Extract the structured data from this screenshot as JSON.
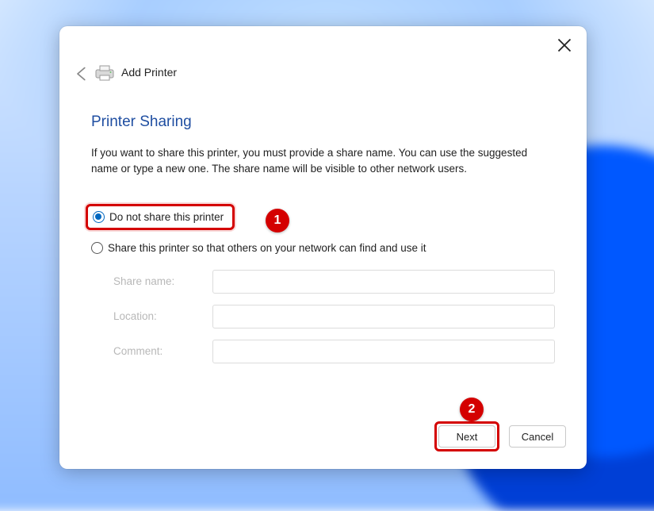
{
  "wizard": {
    "title": "Add Printer",
    "heading": "Printer Sharing",
    "description": "If you want to share this printer, you must provide a share name. You can use the suggested name or type a new one. The share name will be visible to other network users."
  },
  "options": {
    "do_not_share": "Do not share this printer",
    "share": "Share this printer so that others on your network can find and use it",
    "selected": "do_not_share"
  },
  "fields": {
    "share_name_label": "Share name:",
    "share_name_value": "",
    "location_label": "Location:",
    "location_value": "",
    "comment_label": "Comment:",
    "comment_value": ""
  },
  "buttons": {
    "next": "Next",
    "cancel": "Cancel"
  },
  "annotations": {
    "step1": "1",
    "step2": "2"
  }
}
